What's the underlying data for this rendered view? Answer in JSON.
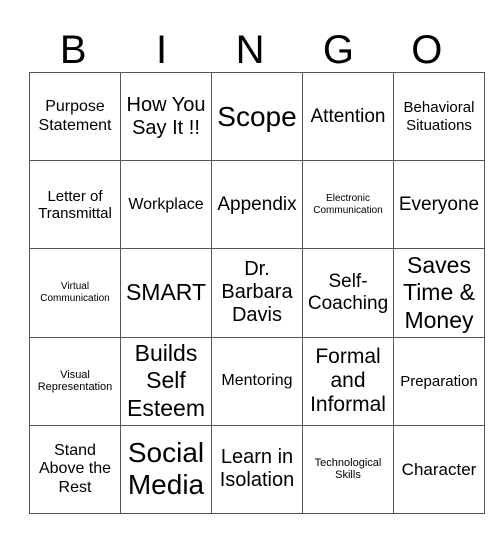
{
  "header": {
    "letters": [
      "B",
      "I",
      "N",
      "G",
      "O"
    ]
  },
  "grid": {
    "rows": [
      [
        "Purpose Statement",
        "How You Say It !!",
        "Scope",
        "Attention",
        "Behavioral Situations"
      ],
      [
        "Letter of Transmittal",
        "Workplace",
        "Appendix",
        "Electronic Communication",
        "Everyone"
      ],
      [
        "Virtual Communication",
        "SMART",
        "Dr. Barbara Davis",
        "Self-Coaching",
        "Saves Time & Money"
      ],
      [
        "Visual Representation",
        "Builds Self Esteem",
        "Mentoring",
        "Formal and Informal",
        "Preparation"
      ],
      [
        "Stand Above the Rest",
        "Social Media",
        "Learn in Isolation",
        "Technological Skills",
        "Character"
      ]
    ]
  }
}
